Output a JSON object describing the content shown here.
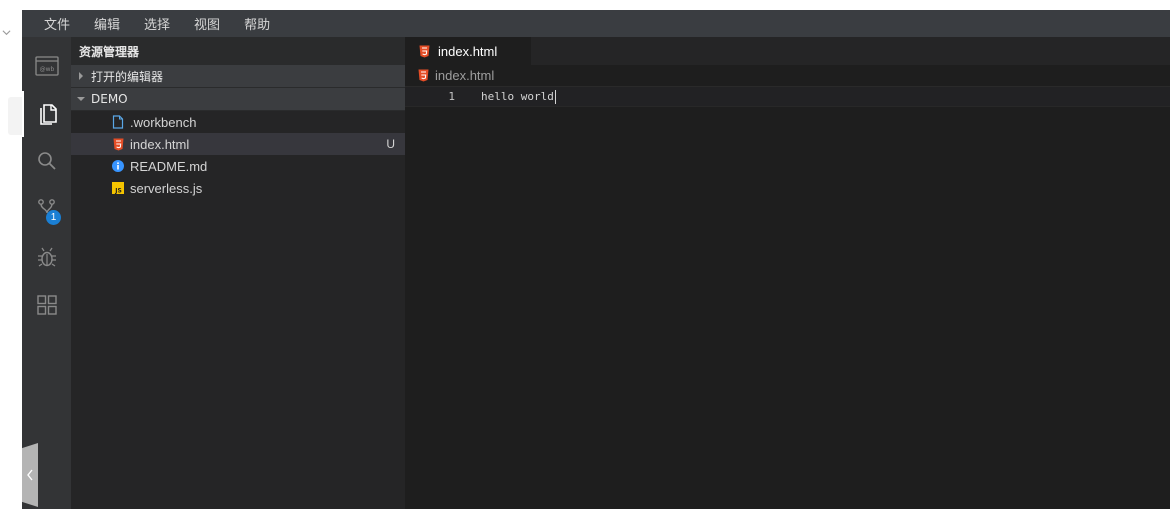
{
  "menubar": {
    "items": [
      "文件",
      "编辑",
      "选择",
      "视图",
      "帮助"
    ]
  },
  "activitybar": {
    "items": [
      {
        "name": "workbench-icon"
      },
      {
        "name": "explorer-icon"
      },
      {
        "name": "search-icon"
      },
      {
        "name": "source-control-icon",
        "badge": "1"
      },
      {
        "name": "debug-icon"
      },
      {
        "name": "extensions-icon"
      }
    ]
  },
  "sidebar": {
    "title": "资源管理器",
    "open_editors_label": "打开的编辑器",
    "project_label": "DEMO",
    "files": [
      {
        "label": ".workbench",
        "icon": "file-icon",
        "status": ""
      },
      {
        "label": "index.html",
        "icon": "html-icon",
        "status": "U"
      },
      {
        "label": "README.md",
        "icon": "info-icon",
        "status": ""
      },
      {
        "label": "serverless.js",
        "icon": "js-icon",
        "status": ""
      }
    ]
  },
  "editor": {
    "tab_label": "index.html",
    "breadcrumb": "index.html",
    "lines": [
      {
        "number": "1",
        "text": "hello world"
      }
    ]
  },
  "colors": {
    "html_icon": "#e44d26",
    "info_icon": "#3794ff",
    "js_icon": "#f5c400",
    "badge": "#1a7fd4"
  }
}
